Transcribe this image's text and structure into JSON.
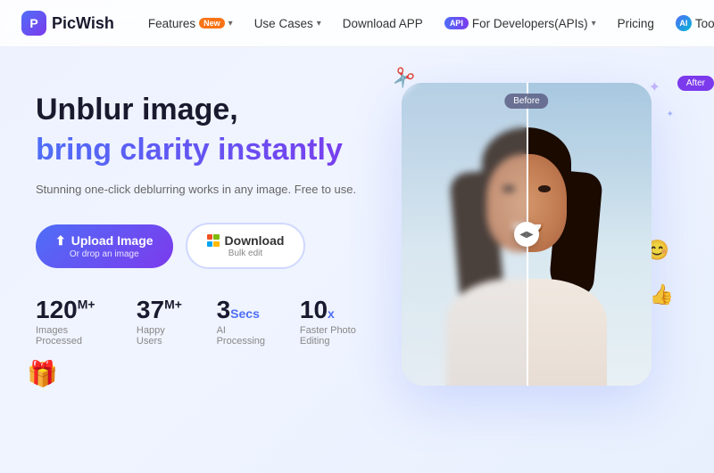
{
  "brand": {
    "name": "PicWish",
    "logo_icon": "🎨"
  },
  "nav": {
    "items": [
      {
        "label": "Features",
        "has_dropdown": true,
        "has_badge": true,
        "badge_text": "New"
      },
      {
        "label": "Use Cases",
        "has_dropdown": true
      },
      {
        "label": "Download APP",
        "has_dropdown": false
      },
      {
        "label": "For Developers(APIs)",
        "has_dropdown": true,
        "has_api_badge": true
      },
      {
        "label": "Pricing",
        "has_dropdown": false
      },
      {
        "label": "Tools",
        "has_dropdown": false,
        "has_ai_badge": true
      }
    ]
  },
  "hero": {
    "title_line1": "Unblur image,",
    "title_line2": "bring clarity instantly",
    "subtitle": "Stunning one-click deblurring works in any image. Free to use.",
    "upload_button": {
      "main": "Upload Image",
      "sub": "Or drop an image"
    },
    "download_button": {
      "main": "Download",
      "sub": "Bulk edit"
    }
  },
  "stats": [
    {
      "number": "120",
      "sup": "M+",
      "unit": null,
      "label": "Images Processed"
    },
    {
      "number": "37",
      "sup": "M+",
      "unit": null,
      "label": "Happy Users"
    },
    {
      "number": "3",
      "sup": null,
      "unit": "Secs",
      "label": "AI Processing"
    },
    {
      "number": "10",
      "sup": null,
      "unit": "x",
      "label": "Faster Photo Editing"
    }
  ],
  "image_demo": {
    "badge_before": "Before",
    "badge_after": "After"
  },
  "colors": {
    "primary": "#4f6ef7",
    "secondary": "#7c3aed",
    "accent_orange": "#f97316"
  }
}
